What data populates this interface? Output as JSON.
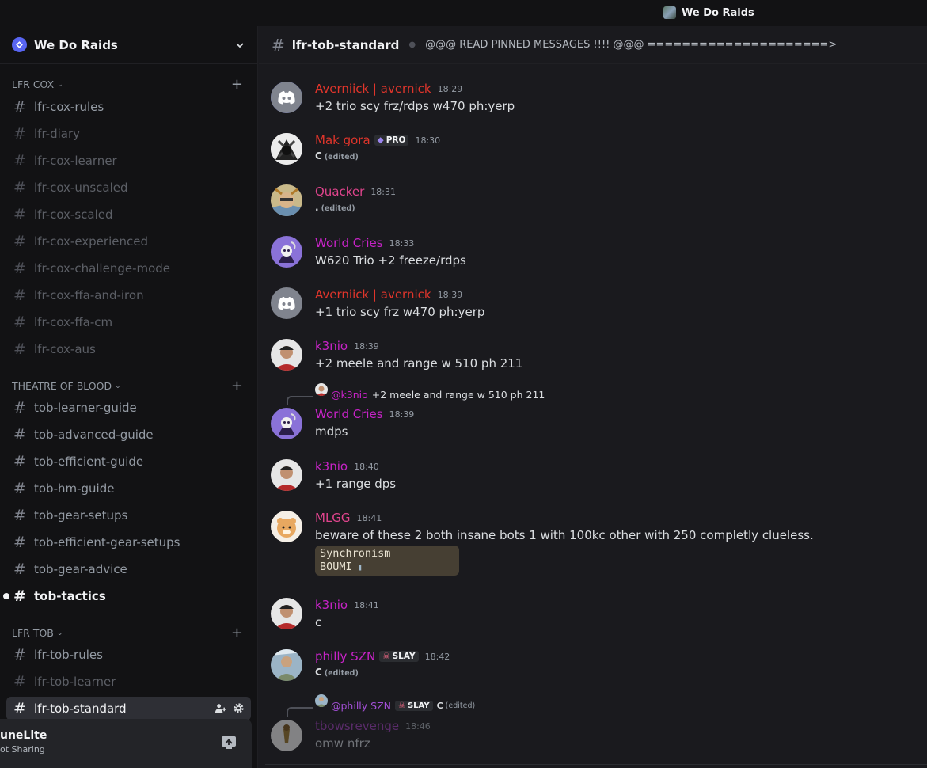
{
  "titlebar": {
    "server_title": "We Do Raids"
  },
  "server": {
    "name": "We Do Raids"
  },
  "categories": {
    "cox": "LFR COX",
    "tob": "THEATRE OF BLOOD",
    "lfrtob": "LFR TOB"
  },
  "channels": {
    "cox": [
      "lfr-cox-rules",
      "lfr-diary",
      "lfr-cox-learner",
      "lfr-cox-unscaled",
      "lfr-cox-scaled",
      "lfr-cox-experienced",
      "lfr-cox-challenge-mode",
      "lfr-cox-ffa-and-iron",
      "lfr-cox-ffa-cm",
      "lfr-cox-aus"
    ],
    "tob": [
      "tob-learner-guide",
      "tob-advanced-guide",
      "tob-efficient-guide",
      "tob-hm-guide",
      "tob-gear-setups",
      "tob-efficient-gear-setups",
      "tob-gear-advice",
      "tob-tactics"
    ],
    "lfrtob": [
      "lfr-tob-rules",
      "lfr-tob-learner",
      "lfr-tob-standard"
    ]
  },
  "stream_panel": {
    "app": "uneLite",
    "status": "ot Sharing"
  },
  "chat": {
    "channel_name": "lfr-tob-standard",
    "topic": "@@@ READ PINNED MESSAGES !!!! @@@ =====================>"
  },
  "messages": [
    {
      "user": "Averniick | avernick",
      "time": "18:29",
      "text": "+2 trio scy frz/rdps w470 ph:yerp"
    },
    {
      "user": "Mak gora",
      "badge": "PRO",
      "time": "18:30",
      "text": "C",
      "edited": "(edited)"
    },
    {
      "user": "Quacker",
      "time": "18:31",
      "text": ".",
      "edited": "(edited)"
    },
    {
      "user": "World Cries",
      "time": "18:33",
      "text": "W620 Trio +2 freeze/rdps"
    },
    {
      "user": "Averniick | avernick",
      "time": "18:39",
      "text": "+1 trio scy frz w470 ph:yerp"
    },
    {
      "user": "k3nio",
      "time": "18:39",
      "text": "+2 meele and range w 510 ph 211"
    },
    {
      "reply_to": "@k3nio",
      "reply_text": "+2 meele and range w 510 ph 211",
      "user": "World Cries",
      "time": "18:39",
      "text": "mdps"
    },
    {
      "user": "k3nio",
      "time": "18:40",
      "text": "+1 range dps"
    },
    {
      "user": "MLGG",
      "time": "18:41",
      "text": "beware of these 2 both insane bots 1 with 100kc other with 250 completly clueless.",
      "image_lines": [
        "Synchronism",
        "BOUMI"
      ]
    },
    {
      "user": "k3nio",
      "time": "18:41",
      "text": "c"
    },
    {
      "user": "philly SZN",
      "badge": "SLAY",
      "time": "18:42",
      "text": "C",
      "edited": "(edited)"
    },
    {
      "reply_to": "@philly SZN",
      "reply_badge": "SLAY",
      "reply_text": "C",
      "reply_edited": "(edited)",
      "user": "tbowsrevenge",
      "time": "18:46",
      "text": "omw nfrz"
    }
  ],
  "colors": {
    "accent": "#5865f2",
    "user_red": "#e0352b",
    "user_pink": "#e0448d",
    "user_magenta": "#c723c7",
    "user_purple": "#a34fd6"
  }
}
